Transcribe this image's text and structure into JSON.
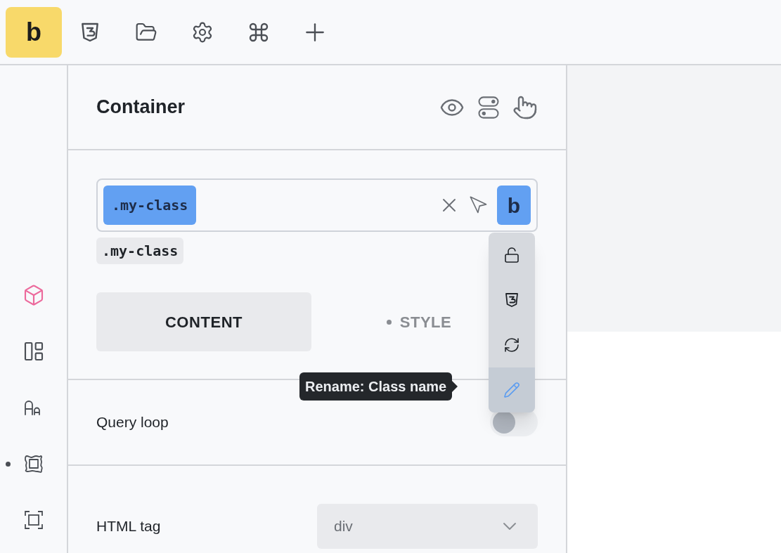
{
  "toolbar": {
    "logo": "b",
    "items": [
      {
        "kind": "css"
      },
      {
        "kind": "folder"
      },
      {
        "kind": "settings"
      },
      {
        "kind": "command"
      },
      {
        "kind": "add"
      }
    ]
  },
  "sidebar": {
    "items": [
      {
        "kind": "element",
        "selected": true,
        "modified": false
      },
      {
        "kind": "layout",
        "selected": false,
        "modified": false
      },
      {
        "kind": "typography",
        "selected": false,
        "modified": false
      },
      {
        "kind": "spacing",
        "selected": false,
        "modified": true
      },
      {
        "kind": "frame",
        "selected": false,
        "modified": false
      }
    ]
  },
  "panel": {
    "title": "Container",
    "class_field": {
      "chip": ".my-class",
      "button": "b"
    },
    "class_tag": ".my-class",
    "tabs": [
      {
        "label": "CONTENT",
        "selected": true,
        "modified": false
      },
      {
        "label": "STYLE",
        "selected": false,
        "modified": true
      }
    ],
    "menu": {
      "items": [
        {
          "kind": "unlock",
          "selected": false
        },
        {
          "kind": "css",
          "selected": false
        },
        {
          "kind": "sync",
          "selected": false
        },
        {
          "kind": "rename",
          "selected": true
        }
      ],
      "tooltip": "Rename: Class name"
    },
    "query_loop": {
      "label": "Query loop",
      "on": false
    },
    "html_tag": {
      "label": "HTML tag",
      "value": "div"
    }
  }
}
